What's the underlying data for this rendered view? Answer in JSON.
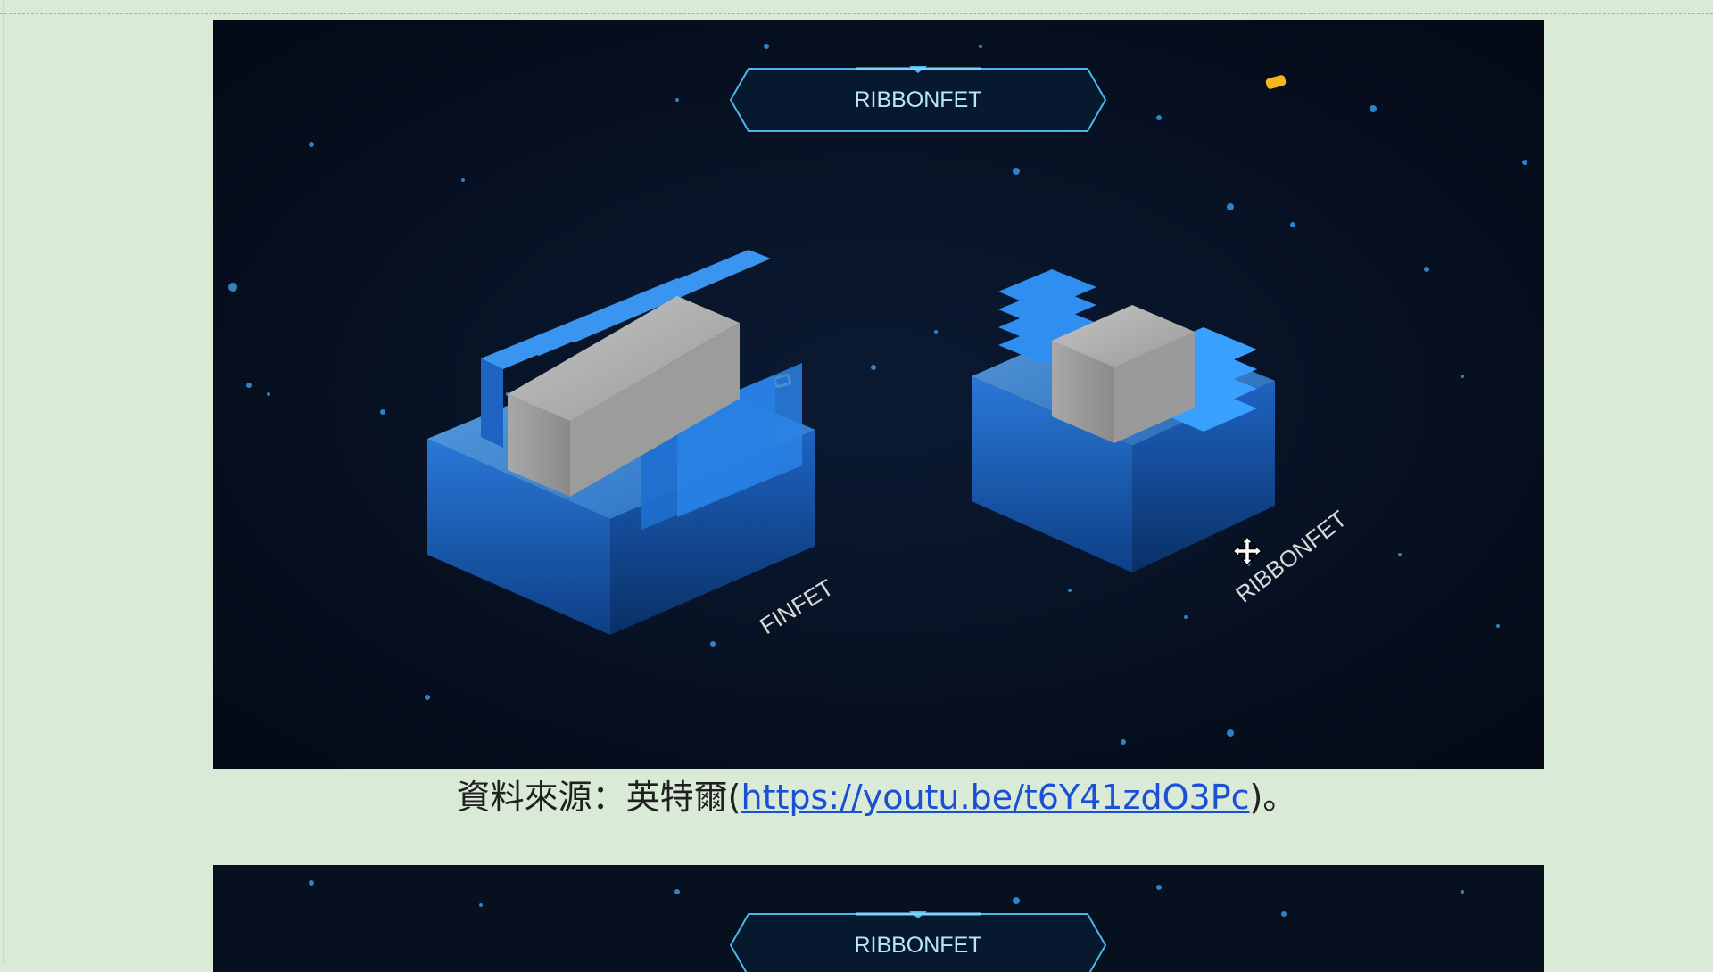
{
  "figure1": {
    "banner_label": "RIBBONFET",
    "left_device_label": "FINFET",
    "right_device_label": "RIBBONFET"
  },
  "caption": {
    "prefix": "資料來源：英特爾(",
    "link_text": "https://youtu.be/t6Y41zdO3Pc",
    "suffix": ")。"
  },
  "figure2": {
    "banner_label": "RIBBONFET"
  },
  "icons": {
    "cursor": "move-cursor-icon"
  }
}
